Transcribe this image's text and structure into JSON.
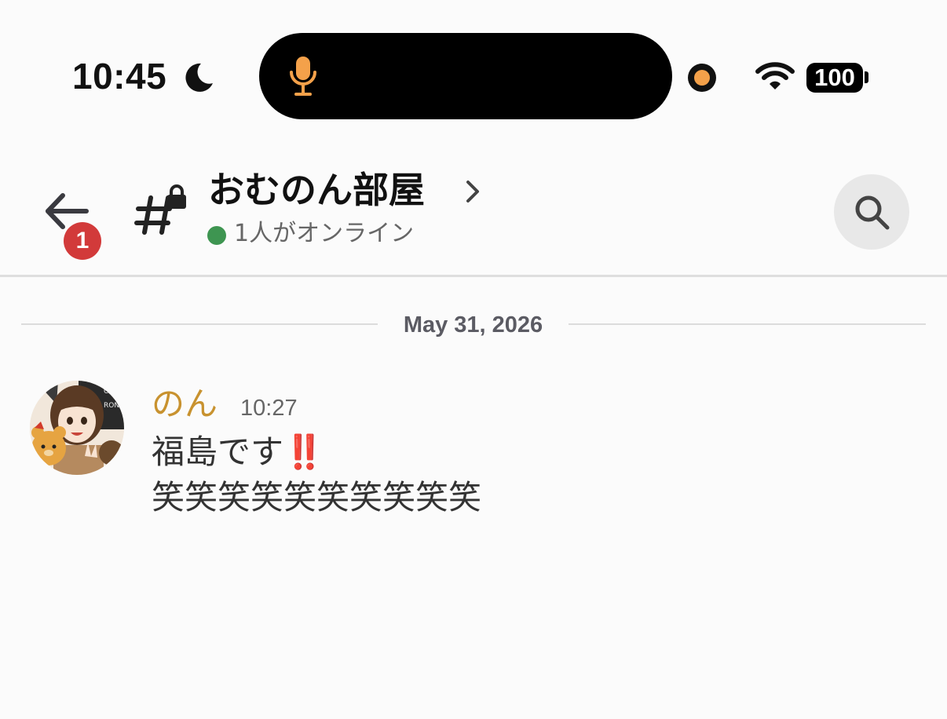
{
  "status_bar": {
    "time": "10:45",
    "battery": "100",
    "icons": [
      "moon-icon",
      "microphone-icon",
      "recording-dot-icon",
      "wifi-icon",
      "battery-icon"
    ],
    "colors": {
      "mic": "#f4a14a",
      "recording_dot": "#f4a14a"
    }
  },
  "header": {
    "unread_badge": "1",
    "channel_name": "おむのん部屋",
    "online_status": "1人がオンライン",
    "icons": [
      "back-arrow-icon",
      "private-channel-icon",
      "chevron-right-icon",
      "search-icon"
    ],
    "colors": {
      "online_dot": "#3e9551",
      "badge": "#d23a3a"
    }
  },
  "date_divider": {
    "label": "May 31, 2026"
  },
  "messages": [
    {
      "username": "のん",
      "time": "10:27",
      "lines": [
        "福島です",
        "笑笑笑笑笑笑笑笑笑笑"
      ],
      "emoji": "‼️",
      "colors": {
        "username": "#c8922f"
      }
    }
  ]
}
